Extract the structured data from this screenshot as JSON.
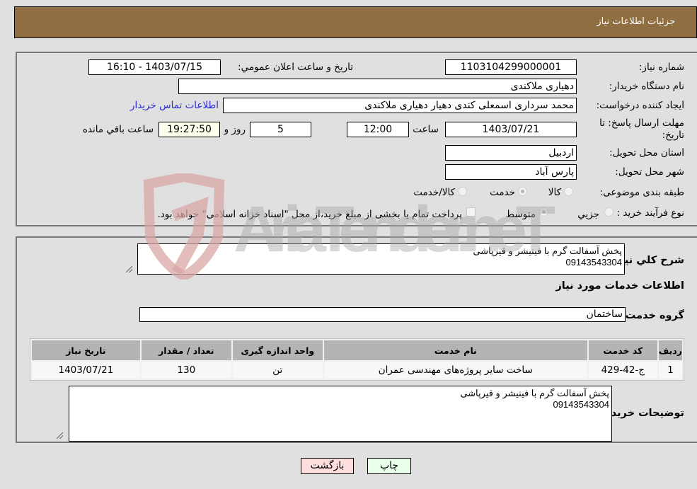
{
  "header": {
    "title": "جزئیات اطلاعات نیاز"
  },
  "form": {
    "need_number": {
      "label": "شماره نیاز:",
      "value": "1103104299000001"
    },
    "announce_datetime": {
      "label": "تاریخ و ساعت اعلان عمومي:",
      "value": "1403/07/15 - 16:10"
    },
    "buyer_org": {
      "label": "نام دستگاه خريدار:",
      "value": "دهیاری ملاکندی"
    },
    "requester": {
      "label": "ایجاد کننده درخواست:",
      "value": "محمد سرداری اسمعلی کندی دهیار دهیاری ملاکندی"
    },
    "buyer_contact_link": "اطلاعات تماس خریدار",
    "deadline": {
      "label_line1": "مهلت ارسال پاسخ: تا",
      "label_line2": "تاریخ:",
      "date": "1403/07/21",
      "time_label": "ساعت",
      "time": "12:00",
      "days": "5",
      "days_label": "روز و",
      "remaining": "19:27:50",
      "remaining_label": "ساعت باقي مانده"
    },
    "province": {
      "label": "استان محل تحویل:",
      "value": "اردبیل"
    },
    "city": {
      "label": "شهر محل تحویل:",
      "value": "پارس آباد"
    },
    "category": {
      "label": "طبقه بندی موضوعی:",
      "options": [
        "کالا",
        "خدمت",
        "کالا/خدمت"
      ],
      "selected": "خدمت"
    },
    "purchase_type": {
      "label": "نوع فرآیند خرید :",
      "options": [
        "جزيي",
        "متوسط"
      ],
      "selected": "متوسط",
      "treasury_note": "پرداخت تمام یا بخشی از مبلغ خرید،از محل \"اسناد خزانه اسلامی\" خواهد بود.",
      "treasury_checked": false
    }
  },
  "details": {
    "general_desc_label": "شرح کلي نياز:",
    "general_desc": "پخش آسفالت گرم با فینیشر و قیرپاشی\n09143543304",
    "services_title": "اطلاعات خدمات مورد نیاز",
    "service_group_label": "گروه خدمت:",
    "service_group": "ساختمان",
    "table": {
      "headers": [
        "ردیف",
        "کد خدمت",
        "نام خدمت",
        "واحد اندازه گیری",
        "تعداد / مقدار",
        "تاریخ نیاز"
      ],
      "rows": [
        [
          "1",
          "ج-42-429",
          "ساخت سایر پروژه‌های مهندسی عمران",
          "تن",
          "130",
          "1403/07/21"
        ]
      ]
    },
    "buyer_notes_label": "توضیحات خریدار:",
    "buyer_notes": "پخش آسفالت گرم با فینیشر و قیرپاشی\n09143543304"
  },
  "buttons": {
    "print": "چاپ",
    "back": "بازگشت"
  },
  "watermark": {
    "text": "AriaTender.neT"
  },
  "colors": {
    "header_bg": "#8f6e41",
    "print_bg": "#eaffea",
    "back_bg": "#ffdede",
    "link": "#2a2ad0"
  }
}
